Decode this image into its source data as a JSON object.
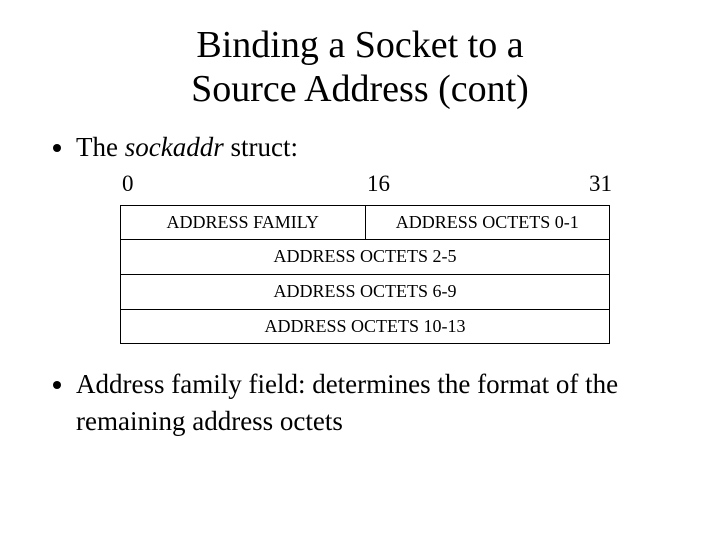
{
  "title_line1": "Binding a Socket to a",
  "title_line2": "Source Address (cont)",
  "bullet1_prefix": "The ",
  "bullet1_italic": "sockaddr",
  "bullet1_suffix": " struct:",
  "bits": {
    "b0": "0",
    "b16": "16",
    "b31": "31"
  },
  "struct": {
    "r0c0": "ADDRESS FAMILY",
    "r0c1": "ADDRESS OCTETS 0-1",
    "r1": "ADDRESS OCTETS 2-5",
    "r2": "ADDRESS OCTETS 6-9",
    "r3": "ADDRESS OCTETS 10-13"
  },
  "bullet2": "Address family field: determines the format of the remaining address octets"
}
